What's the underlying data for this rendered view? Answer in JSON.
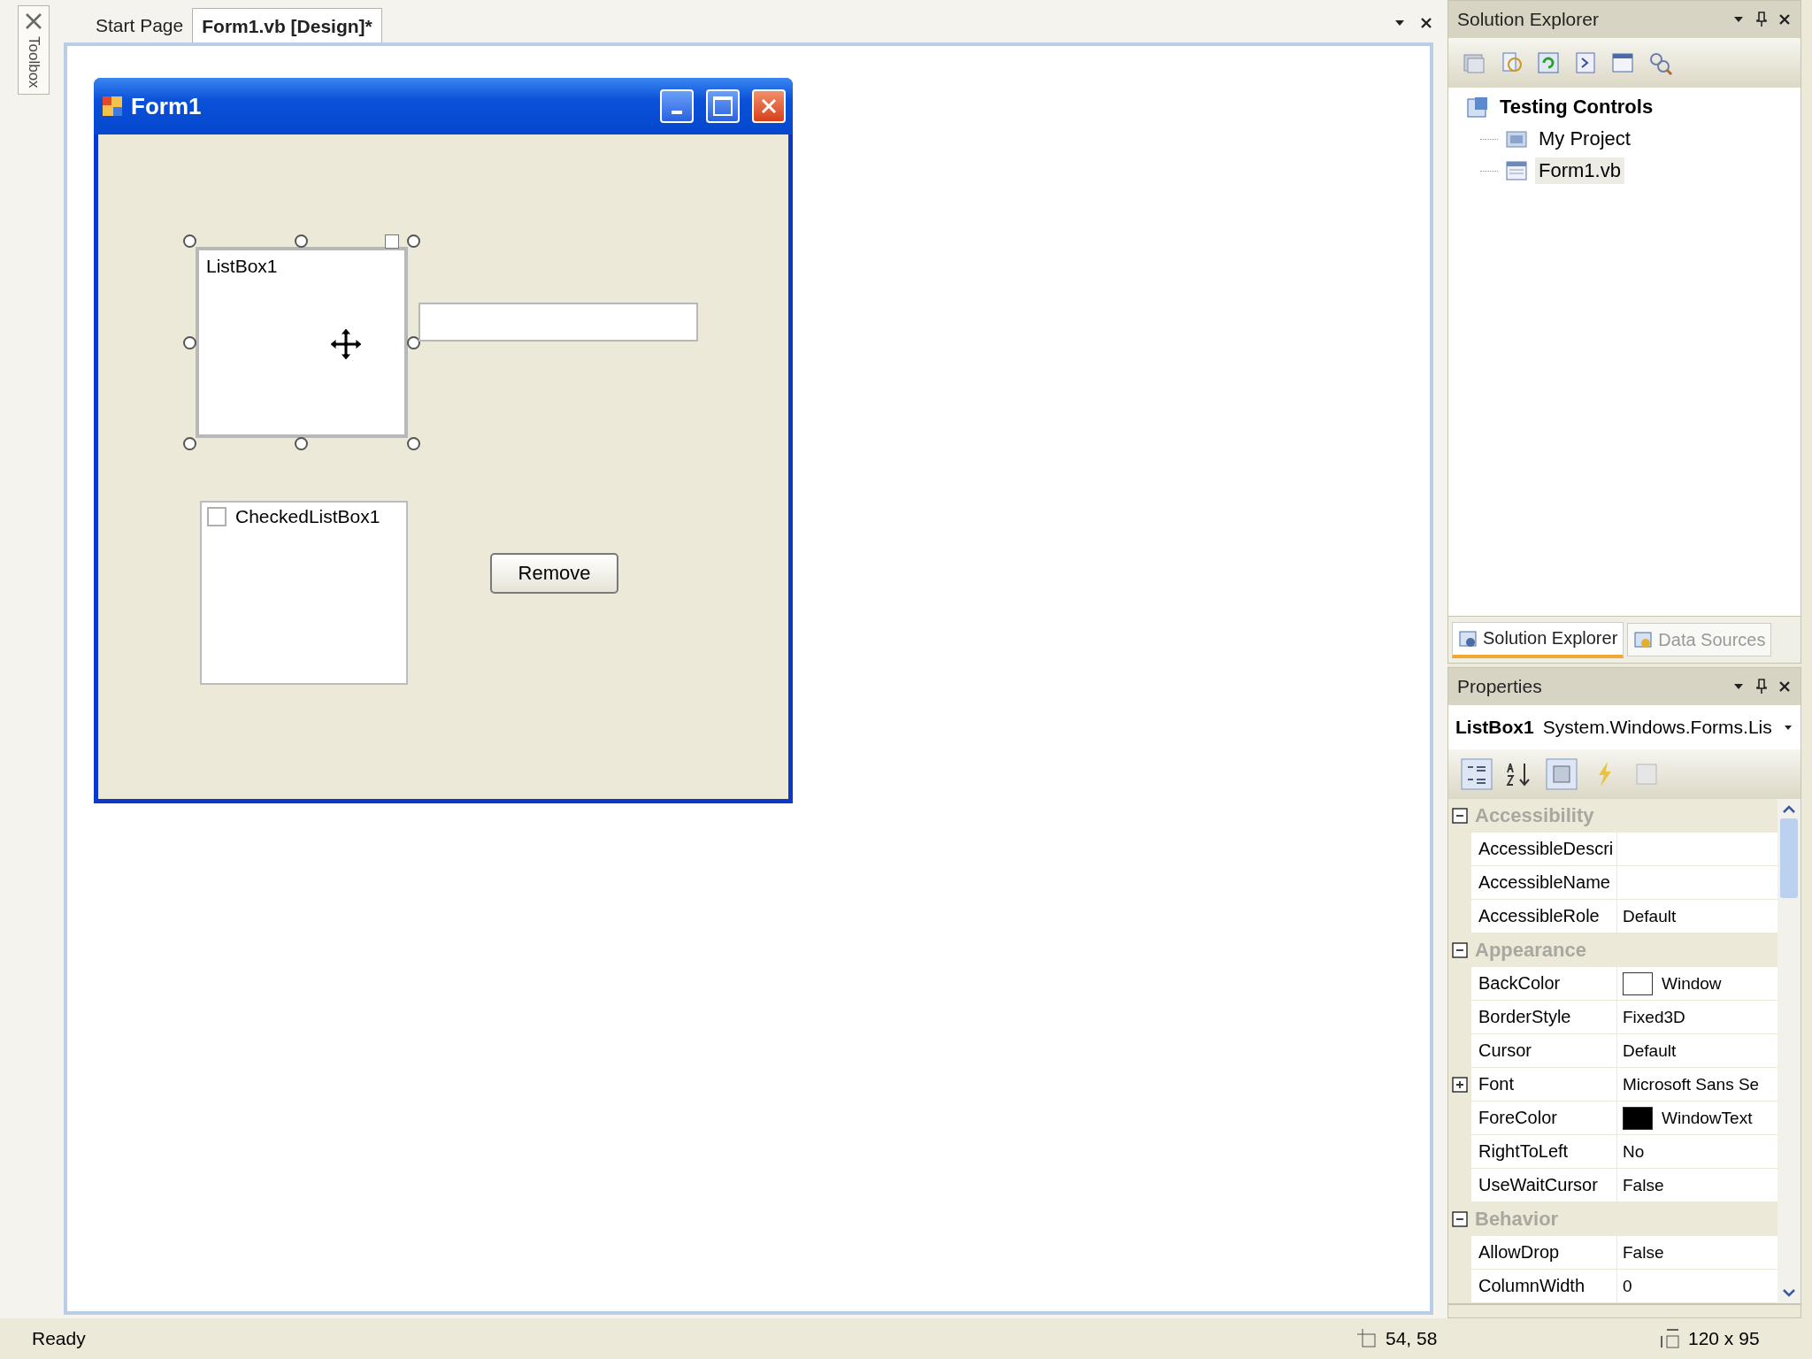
{
  "document_tabs": [
    {
      "label": "Start Page",
      "selected": false
    },
    {
      "label": "Form1.vb [Design]*",
      "selected": true
    }
  ],
  "toolbox": {
    "label": "Toolbox"
  },
  "form": {
    "title": "Form1",
    "listbox": {
      "item": "ListBox1",
      "selected": true
    },
    "checked_listbox": {
      "items": [
        {
          "label": "CheckedListBox1",
          "checked": false
        }
      ]
    },
    "button": {
      "label": "Remove"
    }
  },
  "solution_explorer": {
    "title": "Solution Explorer",
    "tree": [
      {
        "label": "Testing Controls",
        "selected": false,
        "children": [
          {
            "label": "My Project",
            "selected": false
          },
          {
            "label": "Form1.vb",
            "selected": true
          }
        ]
      }
    ],
    "tabs": [
      {
        "label": "Solution Explorer",
        "selected": true
      },
      {
        "label": "Data Sources",
        "selected": false
      }
    ]
  },
  "properties": {
    "title": "Properties",
    "object_name": "ListBox1",
    "object_type": "System.Windows.Forms.Lis",
    "categories": [
      {
        "name": "Accessibility",
        "expanded": true,
        "rows": [
          {
            "name": "AccessibleDescri",
            "value": "",
            "expandable": false
          },
          {
            "name": "AccessibleName",
            "value": "",
            "expandable": false
          },
          {
            "name": "AccessibleRole",
            "value": "Default",
            "expandable": false
          }
        ]
      },
      {
        "name": "Appearance",
        "expanded": true,
        "rows": [
          {
            "name": "BackColor",
            "value": "Window",
            "color": "#ffffff",
            "expandable": false
          },
          {
            "name": "BorderStyle",
            "value": "Fixed3D",
            "expandable": false
          },
          {
            "name": "Cursor",
            "value": "Default",
            "expandable": false
          },
          {
            "name": "Font",
            "value": "Microsoft Sans Se",
            "expandable": true
          },
          {
            "name": "ForeColor",
            "value": "WindowText",
            "color": "#000000",
            "expandable": false
          },
          {
            "name": "RightToLeft",
            "value": "No",
            "expandable": false
          },
          {
            "name": "UseWaitCursor",
            "value": "False",
            "expandable": false
          }
        ]
      },
      {
        "name": "Behavior",
        "expanded": true,
        "rows": [
          {
            "name": "AllowDrop",
            "value": "False",
            "expandable": false
          },
          {
            "name": "ColumnWidth",
            "value": "0",
            "expandable": false
          }
        ]
      }
    ]
  },
  "status_bar": {
    "text": "Ready",
    "position": "54, 58",
    "size": "120 x 95"
  }
}
